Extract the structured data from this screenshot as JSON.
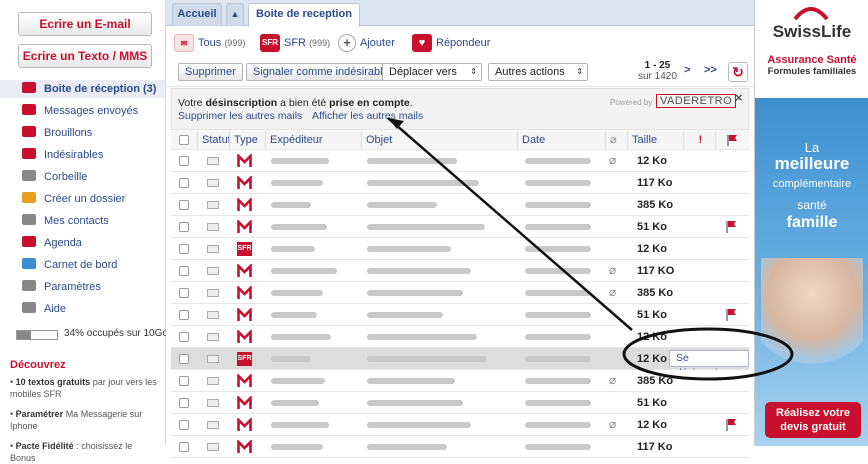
{
  "left": {
    "email_btn": "Ecrire un E-mail",
    "sms_btn": "Ecrire un Texto / MMS",
    "folders": [
      {
        "label": "Boite de réception (3)",
        "icon": "inbox-icon",
        "color": "#c8102e",
        "bold": true
      },
      {
        "label": "Messages envoyés",
        "icon": "sent-icon",
        "color": "#c8102e"
      },
      {
        "label": "Brouillons",
        "icon": "drafts-icon",
        "color": "#c8102e"
      },
      {
        "label": "Indésirables",
        "icon": "spam-icon",
        "color": "#c8102e"
      },
      {
        "label": "Corbeille",
        "icon": "trash-icon",
        "color": "#888888"
      },
      {
        "label": "Créer un dossier",
        "icon": "new-folder-icon",
        "color": "#e8a020"
      },
      {
        "label": "Mes contacts",
        "icon": "contacts-icon",
        "color": "#888888"
      },
      {
        "label": "Agenda",
        "icon": "calendar-icon",
        "color": "#c8102e"
      },
      {
        "label": "Carnet de bord",
        "icon": "logbook-icon",
        "color": "#3a8fd0"
      },
      {
        "label": "Paramètres",
        "icon": "settings-icon",
        "color": "#888888"
      },
      {
        "label": "Aide",
        "icon": "help-icon",
        "color": "#888888"
      }
    ],
    "quota_text": "34% occupés sur 10Go",
    "quota_fraction": 0.34,
    "discover_title": "Découvrez",
    "promos": [
      {
        "bold": "10 textos gratuits",
        "text": " par jour vers les mobiles SFR"
      },
      {
        "bold": "Paramétrer",
        "text": " Ma Messagerie sur Iphone"
      },
      {
        "bold": "Pacte Fidélité",
        "text": " : choisissez le Bonus"
      }
    ]
  },
  "tabs": {
    "home": "Accueil",
    "inbox": "Boite de reception"
  },
  "filters": {
    "all": "Tous",
    "all_count": "(999)",
    "sfr": "SFR",
    "sfr_count": "(999)",
    "add": "Ajouter",
    "responder": "Répondeur"
  },
  "toolbar": {
    "delete": "Supprimer",
    "spam": "Signaler comme indésirable",
    "move": "Déplacer vers",
    "other": "Autres actions",
    "range": "1 - 25",
    "total": "sur 1420",
    "next": ">",
    "last": ">>"
  },
  "notice": {
    "prefix": "Votre ",
    "bold1": "désinscription",
    "mid": " a bien été ",
    "bold2": "prise en compte",
    "suffix": ".",
    "link1": "Supprimer les autres mails",
    "link2": "Afficher les autres mails",
    "powered": "Powered by",
    "brand": "VADERETRO",
    "close": "×"
  },
  "columns": {
    "status": "Statut",
    "type": "Type",
    "sender": "Expéditeur",
    "subject": "Objet",
    "date": "Date",
    "size": "Taille",
    "important": "!"
  },
  "rows": [
    {
      "type": "M",
      "size": "12 Ko",
      "clip": true,
      "flag": false
    },
    {
      "type": "M",
      "size": "117 Ko",
      "clip": false,
      "flag": false
    },
    {
      "type": "M",
      "size": "385 Ko",
      "clip": false,
      "flag": false
    },
    {
      "type": "M",
      "size": "51 Ko",
      "clip": false,
      "flag": true
    },
    {
      "type": "SFR",
      "size": "12 Ko",
      "clip": false,
      "flag": false
    },
    {
      "type": "M",
      "size": "117 KO",
      "clip": true,
      "flag": false
    },
    {
      "type": "M",
      "size": "385 Ko",
      "clip": true,
      "flag": false
    },
    {
      "type": "M",
      "size": "51 Ko",
      "clip": false,
      "flag": true
    },
    {
      "type": "M",
      "size": "12 Ko",
      "clip": false,
      "flag": false
    },
    {
      "type": "SFR",
      "size": "12 Ko",
      "clip": false,
      "flag": false,
      "highlight": true,
      "action": "Se désinscrire"
    },
    {
      "type": "M",
      "size": "385 Ko",
      "clip": true,
      "flag": false
    },
    {
      "type": "M",
      "size": "51 Ko",
      "clip": false,
      "flag": false
    },
    {
      "type": "M",
      "size": "12 Ko",
      "clip": true,
      "flag": true
    },
    {
      "type": "M",
      "size": "117 Ko",
      "clip": false,
      "flag": false
    }
  ],
  "ad": {
    "brand": "SwissLife",
    "tag1": "Assurance Santé",
    "tag2": "Formules familiales",
    "line1": "La",
    "line2": "meilleure",
    "line3": "complémentaire",
    "line4": "santé",
    "line5": "famille",
    "cta": "Réalisez votre devis gratuit"
  },
  "colors": {
    "accent": "#c8102e",
    "link": "#2b4a8c"
  }
}
